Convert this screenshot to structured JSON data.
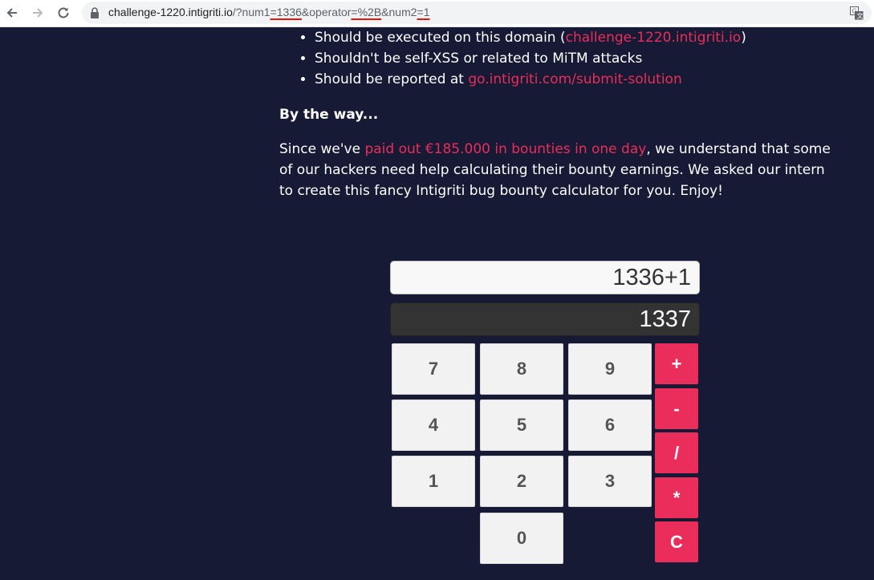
{
  "browser": {
    "url_host": "challenge-1220.intigriti.io",
    "url_path_1": "/?num1",
    "url_eq_1": "=",
    "url_num1": "1336",
    "url_op_key": "&operator",
    "url_eq_2": "=",
    "url_op_val": "%2B",
    "url_num2_key": "&num2",
    "url_eq_3": "=",
    "url_num2_val": "1"
  },
  "rules": [
    {
      "prefix": "Should be executed on this domain (",
      "link": "challenge-1220.intigriti.io",
      "suffix": ")"
    },
    {
      "text": "Shouldn't be self-XSS or related to MiTM attacks"
    },
    {
      "prefix": "Should be reported at ",
      "link": "go.intigriti.com/submit-solution"
    }
  ],
  "btw": {
    "heading": "By the way...",
    "text_before": "Since we've ",
    "link": "paid out €185.000 in bounties in one day",
    "text_after": ", we understand that some of our hackers need help calculating their bounty earnings. We asked our intern to create this fancy Intigriti bug bounty calculator for you. Enjoy!"
  },
  "calculator": {
    "input": "1336+1",
    "result": "1337",
    "digits": [
      "7",
      "8",
      "9",
      "4",
      "5",
      "6",
      "1",
      "2",
      "3",
      "0"
    ],
    "ops": [
      "+",
      "-",
      "/",
      "*",
      "C"
    ]
  },
  "colors": {
    "background": "#161a35",
    "accent": "#ea2d5a",
    "url_underline": "#e8150e"
  }
}
